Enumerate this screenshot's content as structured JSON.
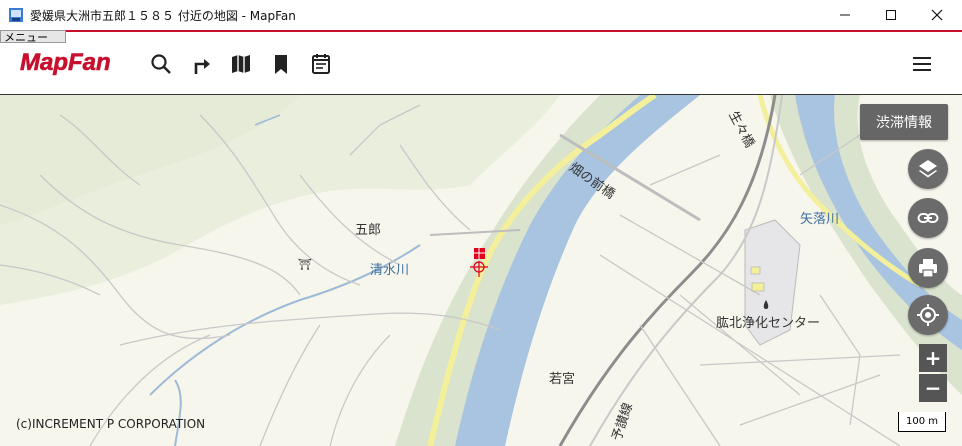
{
  "window": {
    "title": "愛媛県大洲市五郎１５８５ 付近の地図 - MapFan"
  },
  "menu_tag": "メニュー",
  "logo_text": "MapFan",
  "toolbar": {
    "icons": [
      "search-icon",
      "route-icon",
      "map-icon",
      "bookmark-icon",
      "calendar-icon"
    ]
  },
  "map": {
    "labels": {
      "goro": "五郎",
      "seisui_river": "清水川",
      "hatano_maebashi": "畑の前橋",
      "yaochi_river": "矢落川",
      "facility": "肱北浄化センター",
      "wakamiya": "若宮",
      "yosan_line": "予讃線",
      "shosho_bridge": "生々橋",
      "shrine_mark": "⛩"
    },
    "copyright": "(c)INCREMENT P CORPORATION",
    "scale": "100 m"
  },
  "controls": {
    "traffic_button": "渋滞情報",
    "layer_icon": "layers-icon",
    "link_icon": "link-icon",
    "print_icon": "print-icon",
    "location_icon": "location-icon",
    "zoom_in": "+",
    "zoom_out": "−"
  },
  "colors": {
    "brand_red": "#c8102e",
    "river": "#a8c4e0",
    "green": "#d8e3cf",
    "land": "#f7f6ec"
  }
}
